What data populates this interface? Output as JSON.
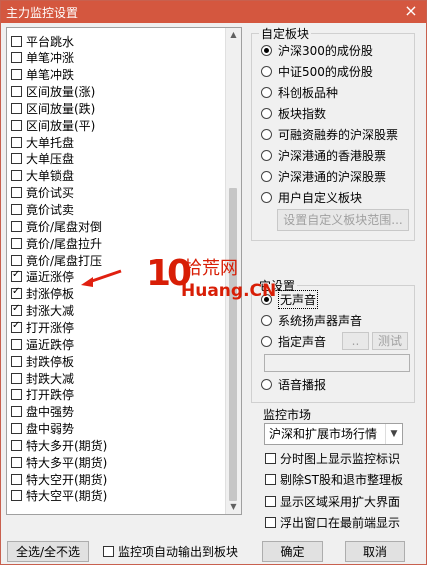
{
  "window": {
    "title": "主力监控设置",
    "close": "×"
  },
  "list": {
    "items": [
      {
        "label": "平台跳水",
        "checked": false
      },
      {
        "label": "单笔冲涨",
        "checked": false
      },
      {
        "label": "单笔冲跌",
        "checked": false
      },
      {
        "label": "区间放量(涨)",
        "checked": false
      },
      {
        "label": "区间放量(跌)",
        "checked": false
      },
      {
        "label": "区间放量(平)",
        "checked": false
      },
      {
        "label": "大单托盘",
        "checked": false
      },
      {
        "label": "大单压盘",
        "checked": false
      },
      {
        "label": "大单锁盘",
        "checked": false
      },
      {
        "label": "竟价试买",
        "checked": false
      },
      {
        "label": "竟价试卖",
        "checked": false
      },
      {
        "label": "竟价/尾盘对倒",
        "checked": false
      },
      {
        "label": "竟价/尾盘拉升",
        "checked": false
      },
      {
        "label": "竟价/尾盘打压",
        "checked": false
      },
      {
        "label": "逼近涨停",
        "checked": true
      },
      {
        "label": "封涨停板",
        "checked": true
      },
      {
        "label": "封涨大减",
        "checked": true
      },
      {
        "label": "打开涨停",
        "checked": true
      },
      {
        "label": "逼近跌停",
        "checked": false
      },
      {
        "label": "封跌停板",
        "checked": false
      },
      {
        "label": "封跌大减",
        "checked": false
      },
      {
        "label": "打开跌停",
        "checked": false
      },
      {
        "label": "盘中强势",
        "checked": false
      },
      {
        "label": "盘中弱势",
        "checked": false
      },
      {
        "label": "特大多开(期货)",
        "checked": false
      },
      {
        "label": "特大多平(期货)",
        "checked": false
      },
      {
        "label": "特大空开(期货)",
        "checked": false
      },
      {
        "label": "特大空平(期货)",
        "checked": false
      }
    ]
  },
  "sector": {
    "title": "自定板块",
    "options": [
      {
        "label": "沪深300的成份股",
        "selected": true
      },
      {
        "label": "中证500的成份股",
        "selected": false
      },
      {
        "label": "科创板品种",
        "selected": false
      },
      {
        "label": "板块指数",
        "selected": false
      },
      {
        "label": "可融资融券的沪深股票",
        "selected": false
      },
      {
        "label": "沪深港通的香港股票",
        "selected": false
      },
      {
        "label": "沪深港通的沪深股票",
        "selected": false
      },
      {
        "label": "用户自定义板块",
        "selected": false
      }
    ],
    "custom_button": "设置自定义板块范围..."
  },
  "sound": {
    "title": "它设置",
    "options": [
      {
        "label": "无声音",
        "selected": true
      },
      {
        "label": "系统扬声器声音",
        "selected": false
      },
      {
        "label": "指定声音",
        "selected": false
      },
      {
        "label": "语音播报",
        "selected": false
      }
    ],
    "browse_button": "..",
    "test_button": "测试"
  },
  "market": {
    "label": "监控市场",
    "selected": "沪深和扩展市场行情"
  },
  "options": [
    {
      "label": "分时图上显示监控标识",
      "checked": false
    },
    {
      "label": "剔除ST股和退市整理板",
      "checked": false
    },
    {
      "label": "显示区域采用扩大界面",
      "checked": false
    },
    {
      "label": "浮出窗口在最前端显示",
      "checked": false
    }
  ],
  "footer": {
    "select_all": "全选/全不选",
    "auto_output": "监控项自动输出到板块",
    "auto_output_checked": false,
    "ok": "确定",
    "cancel": "取消"
  },
  "watermark": {
    "number": "10",
    "cn": "拾荒网",
    "en": "Huang.CN",
    "color": "#d81e06"
  }
}
